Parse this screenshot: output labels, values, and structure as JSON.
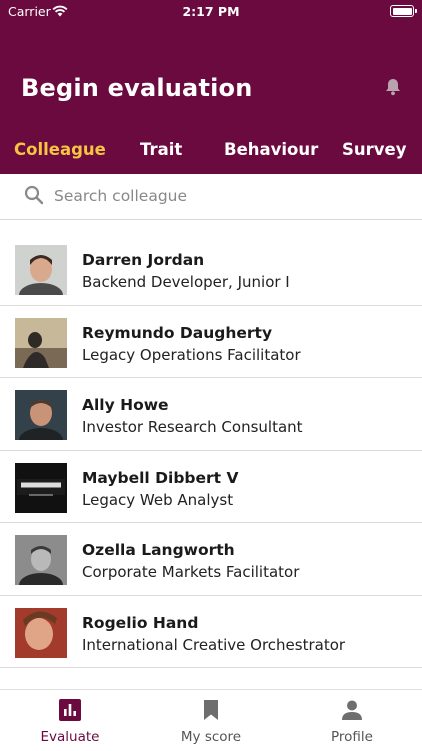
{
  "status_bar": {
    "carrier": "Carrier",
    "time": "2:17 PM"
  },
  "header": {
    "title": "Begin evaluation"
  },
  "tabs": [
    {
      "label": "Colleague",
      "active": true
    },
    {
      "label": "Trait",
      "active": false
    },
    {
      "label": "Behaviour",
      "active": false
    },
    {
      "label": "Survey",
      "active": false
    }
  ],
  "search": {
    "placeholder": "Search colleague",
    "value": ""
  },
  "colleagues": [
    {
      "name": "Darren Jordan",
      "role": "Backend Developer, Junior I"
    },
    {
      "name": "Reymundo Daugherty",
      "role": "Legacy Operations Facilitator"
    },
    {
      "name": "Ally Howe",
      "role": "Investor Research Consultant"
    },
    {
      "name": "Maybell Dibbert V",
      "role": "Legacy Web Analyst"
    },
    {
      "name": "Ozella Langworth",
      "role": "Corporate Markets Facilitator"
    },
    {
      "name": "Rogelio Hand",
      "role": "International Creative Orchestrator"
    }
  ],
  "tabbar": [
    {
      "label": "Evaluate",
      "icon": "bar-chart-icon",
      "active": true
    },
    {
      "label": "My score",
      "icon": "bookmark-icon",
      "active": false
    },
    {
      "label": "Profile",
      "icon": "person-icon",
      "active": false
    }
  ],
  "colors": {
    "brand": "#6b0a3f",
    "accent": "#f5c542"
  }
}
